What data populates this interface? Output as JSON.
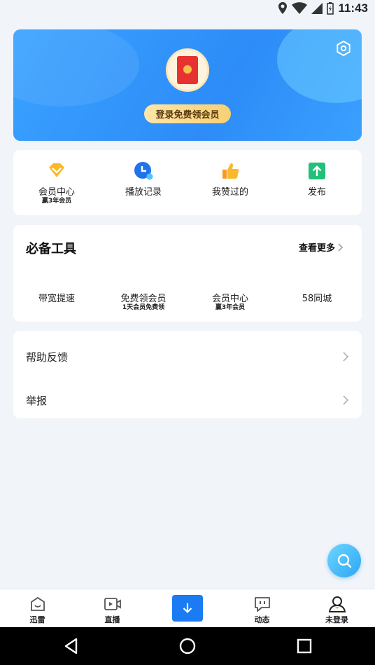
{
  "status_bar": {
    "time": "11:43"
  },
  "hero": {
    "login_button": "登录免费领会员",
    "avatar_badge": "拆"
  },
  "quick_actions": [
    {
      "label": "会员中心",
      "sub": "赢3年会员",
      "icon": "diamond-icon"
    },
    {
      "label": "播放记录",
      "sub": "",
      "icon": "history-clock-icon"
    },
    {
      "label": "我赞过的",
      "sub": "",
      "icon": "thumbs-up-icon"
    },
    {
      "label": "发布",
      "sub": "",
      "icon": "upload-icon"
    }
  ],
  "tools": {
    "title": "必备工具",
    "more": "查看更多",
    "items": [
      {
        "label": "带宽提速",
        "sub": ""
      },
      {
        "label": "免费领会员",
        "sub": "1天会员免费领"
      },
      {
        "label": "会员中心",
        "sub": "赢3年会员"
      },
      {
        "label": "58同城",
        "sub": ""
      }
    ]
  },
  "menu": {
    "help": "帮助反馈",
    "report": "举报"
  },
  "bottom_nav": {
    "items": [
      {
        "label": "迅雷",
        "icon": "home-icon"
      },
      {
        "label": "直播",
        "icon": "live-video-icon"
      },
      {
        "label": "",
        "icon": "download-icon"
      },
      {
        "label": "动态",
        "icon": "message-icon"
      },
      {
        "label": "未登录",
        "icon": "user-icon"
      }
    ]
  },
  "colors": {
    "accent": "#1a7bf2",
    "hero_blue": "#2d8cf8",
    "background": "#f1f4f9"
  }
}
